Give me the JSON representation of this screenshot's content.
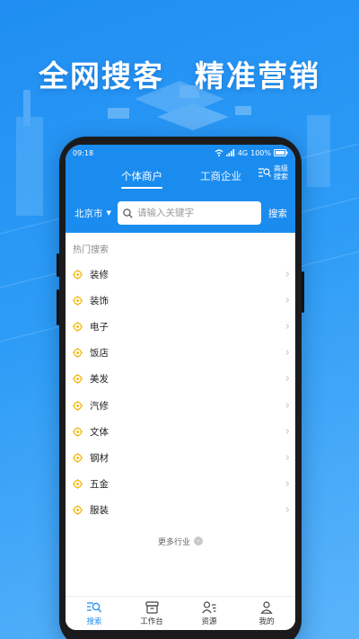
{
  "colors": {
    "brand_blue": "#1a8cf0",
    "target_icon": "#f5b400"
  },
  "banner": {
    "slogan_left": "全网搜客",
    "slogan_right": "精准营销"
  },
  "status_bar": {
    "time": "09:18",
    "network": "4G",
    "battery": "100%"
  },
  "header": {
    "tabs": [
      {
        "label": "个体商户",
        "active": true
      },
      {
        "label": "工商企业",
        "active": false
      }
    ],
    "advanced_search_label": "高级搜索"
  },
  "search": {
    "city": "北京市",
    "placeholder": "请输入关键字",
    "button": "搜索"
  },
  "hot": {
    "title": "热门搜索",
    "items": [
      {
        "label": "装修"
      },
      {
        "label": "装饰"
      },
      {
        "label": "电子"
      },
      {
        "label": "饭店"
      },
      {
        "label": "美发"
      },
      {
        "label": "汽修"
      },
      {
        "label": "文体"
      },
      {
        "label": "钢材"
      },
      {
        "label": "五金"
      },
      {
        "label": "服装"
      }
    ],
    "more_label": "更多行业"
  },
  "tabbar": [
    {
      "label": "搜索",
      "icon": "search-list-icon",
      "active": true
    },
    {
      "label": "工作台",
      "icon": "workbench-icon",
      "active": false
    },
    {
      "label": "资源",
      "icon": "contacts-icon",
      "active": false
    },
    {
      "label": "我的",
      "icon": "user-icon",
      "active": false
    }
  ]
}
